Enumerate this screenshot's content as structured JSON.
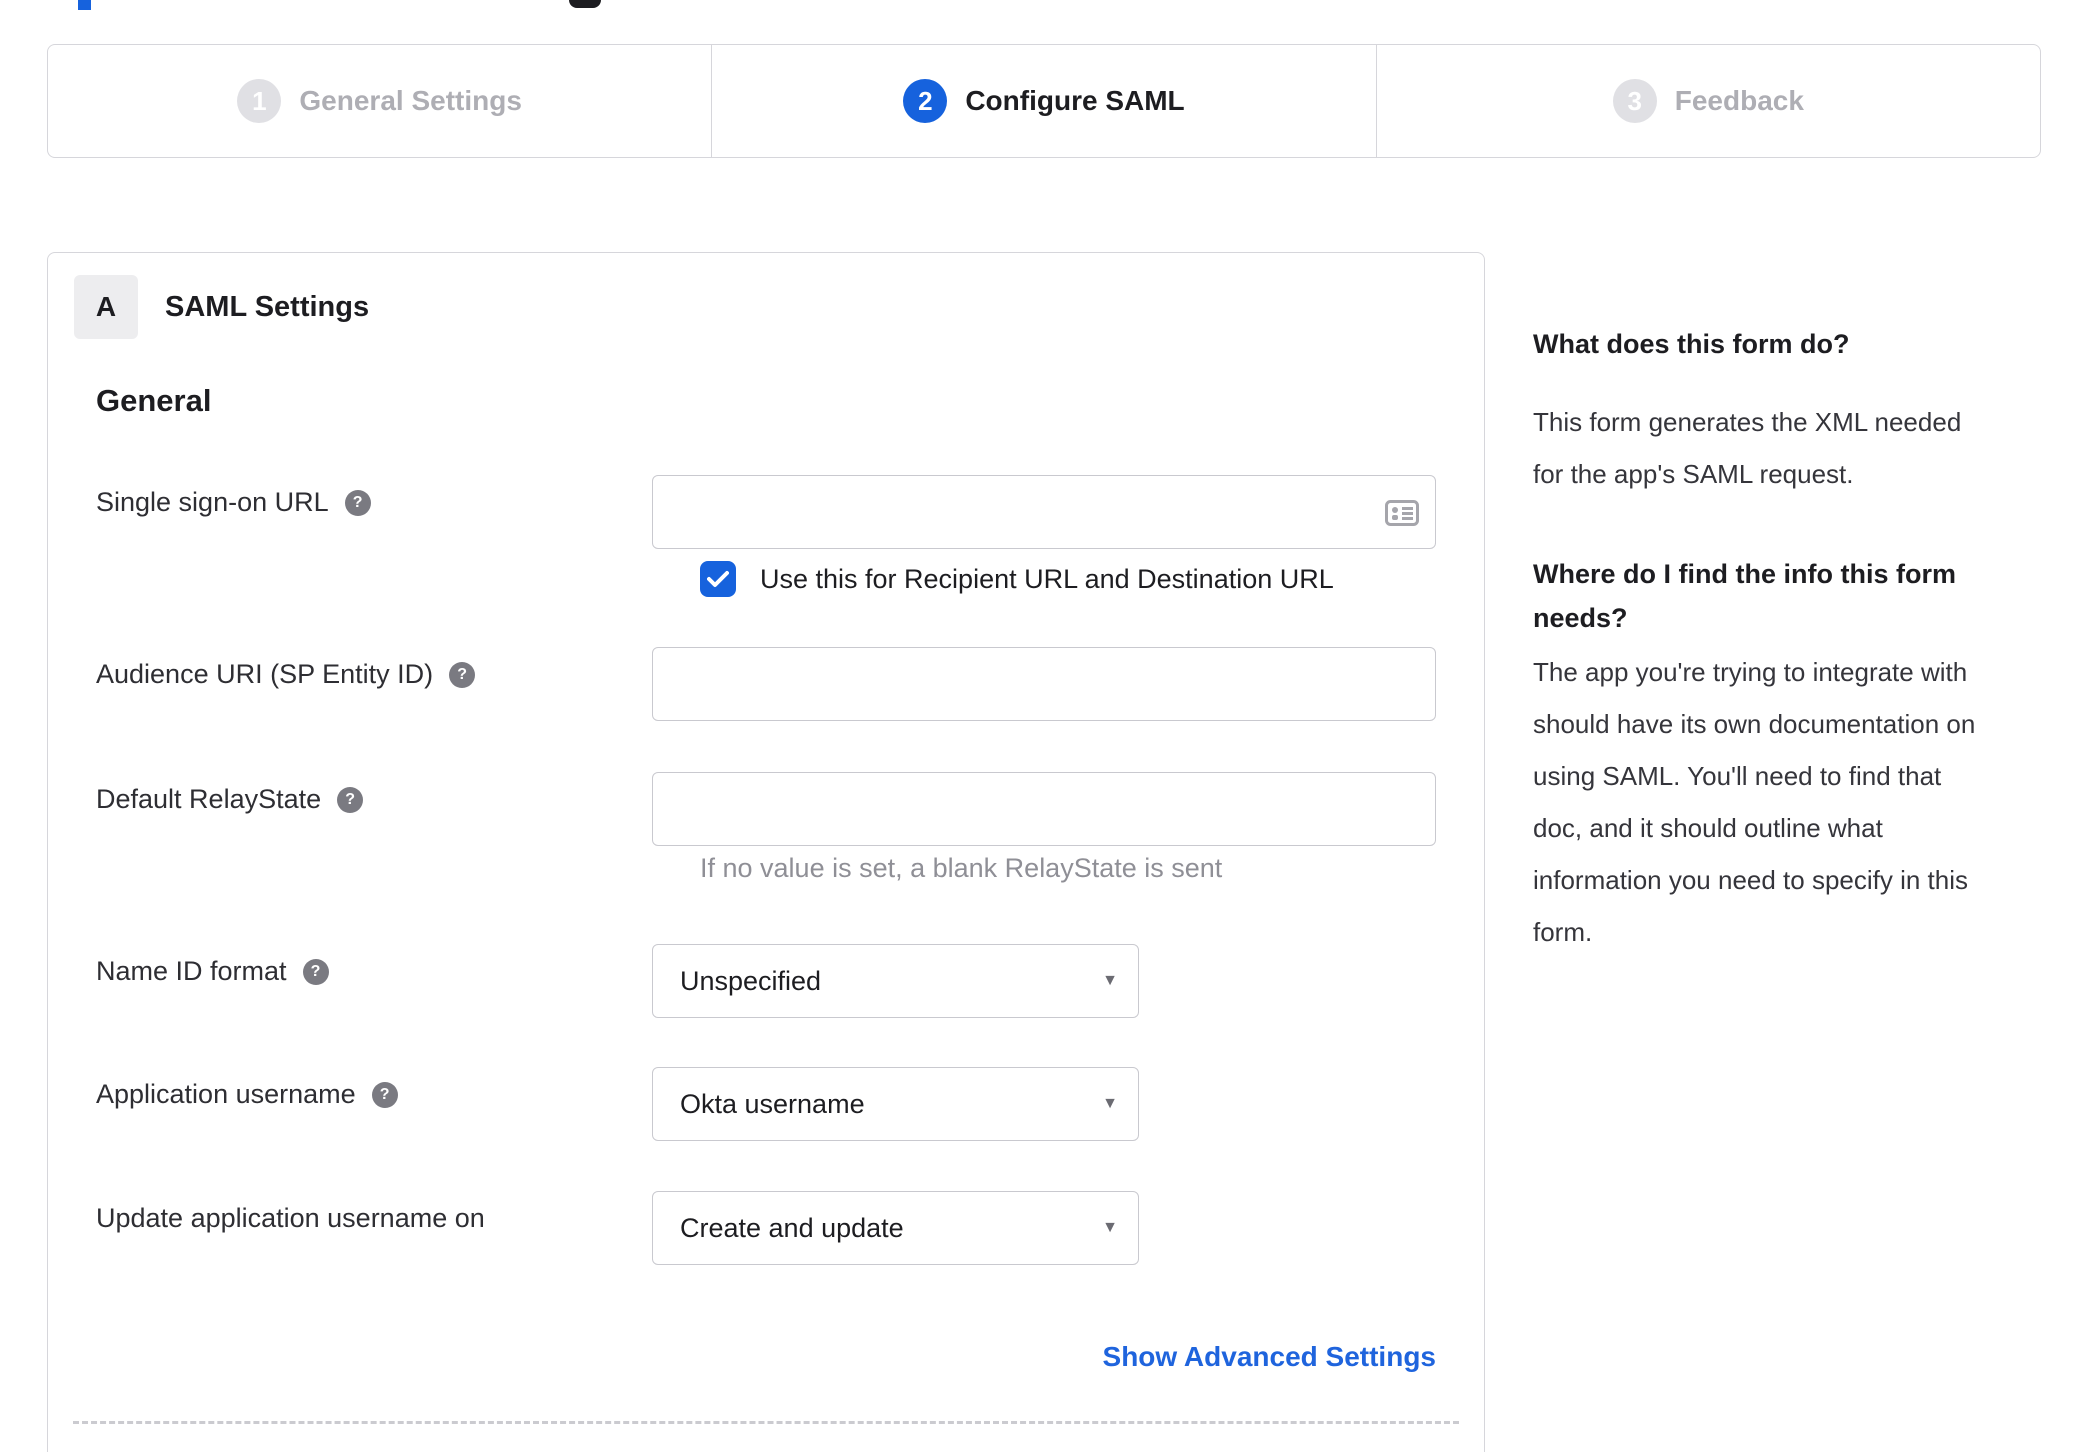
{
  "colors": {
    "accent": "#1662dd",
    "link": "#1f64dd",
    "inactive_gray": "#aeaeb4"
  },
  "icons": {
    "help": "?",
    "dropdown": "▼",
    "sso_field": "contact-card",
    "checkbox_check": "check"
  },
  "stepper": {
    "steps": [
      {
        "num": "1",
        "label": "General Settings",
        "state": "inactive"
      },
      {
        "num": "2",
        "label": "Configure SAML",
        "state": "active"
      },
      {
        "num": "3",
        "label": "Feedback",
        "state": "inactive"
      }
    ]
  },
  "panel": {
    "badge": "A",
    "title": "SAML Settings",
    "section": "General",
    "rows": {
      "sso": {
        "label": "Single sign-on URL",
        "value": "",
        "checkbox_checked": true,
        "checkbox_label": "Use this for Recipient URL and Destination URL"
      },
      "audience": {
        "label": "Audience URI (SP Entity ID)",
        "value": ""
      },
      "relay": {
        "label": "Default RelayState",
        "value": "",
        "hint": "If no value is set, a blank RelayState is sent"
      },
      "nameid": {
        "label": "Name ID format",
        "value": "Unspecified"
      },
      "appuser": {
        "label": "Application username",
        "value": "Okta username"
      },
      "updateuser": {
        "label": "Update application username on",
        "value": "Create and update"
      }
    },
    "advanced_link": "Show Advanced Settings"
  },
  "sidebar": {
    "s1_heading": "What does this form do?",
    "s1_body_lines": [
      "This form generates the XML needed",
      "for the app's SAML request."
    ],
    "s2_heading_lines": [
      "Where do I find the info this form",
      "needs?"
    ],
    "s2_body_lines": [
      "The app you're trying to integrate with",
      "should have its own documentation on",
      "using SAML. You'll need to find that",
      "doc, and it should outline what",
      "information you need to specify in this",
      "form."
    ]
  }
}
